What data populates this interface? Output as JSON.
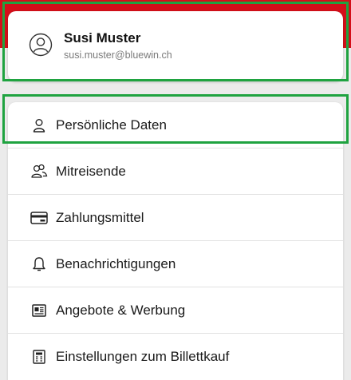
{
  "user": {
    "name": "Susi Muster",
    "email": "susi.muster@bluewin.ch"
  },
  "menu": {
    "items": [
      {
        "label": "Persönliche Daten",
        "icon": "person-icon"
      },
      {
        "label": "Mitreisende",
        "icon": "people-icon"
      },
      {
        "label": "Zahlungsmittel",
        "icon": "credit-card-icon"
      },
      {
        "label": "Benachrichtigungen",
        "icon": "bell-icon"
      },
      {
        "label": "Angebote & Werbung",
        "icon": "newspaper-icon"
      },
      {
        "label": "Einstellungen zum Billettkauf",
        "icon": "ticket-settings-icon"
      }
    ]
  },
  "colors": {
    "brand_red": "#d40f1a",
    "highlight_green": "#1fa340"
  }
}
